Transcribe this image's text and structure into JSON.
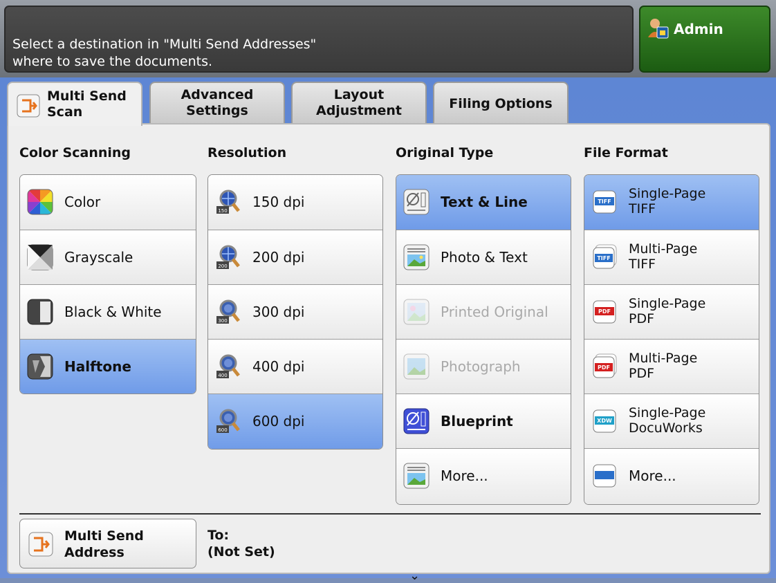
{
  "header": {
    "message_line1": "Select a destination in \"Multi Send Addresses\"",
    "message_line2": "where to save the documents.",
    "admin_label": "Admin",
    "admin_icon": "admin-user-icon"
  },
  "tabs": [
    {
      "line1": "Multi Send",
      "line2": "Scan",
      "active": true,
      "icon": "multi-send-scan-icon"
    },
    {
      "line1": "Advanced",
      "line2": "Settings"
    },
    {
      "line1": "Layout",
      "line2": "Adjustment"
    },
    {
      "line1": "Filing Options",
      "line2": ""
    }
  ],
  "columns": {
    "color_scanning": {
      "heading": "Color Scanning",
      "items": [
        {
          "label": "Color",
          "icon": "color-icon"
        },
        {
          "label": "Grayscale",
          "icon": "grayscale-icon"
        },
        {
          "label": "Black & White",
          "icon": "black-white-icon"
        },
        {
          "label": "Halftone",
          "icon": "halftone-icon",
          "selected": true
        }
      ]
    },
    "resolution": {
      "heading": "Resolution",
      "items": [
        {
          "label": "150 dpi",
          "badge": "150",
          "icon": "resolution-icon"
        },
        {
          "label": "200 dpi",
          "badge": "200",
          "icon": "resolution-icon"
        },
        {
          "label": "300 dpi",
          "badge": "300",
          "icon": "resolution-icon"
        },
        {
          "label": "400 dpi",
          "badge": "400",
          "icon": "resolution-icon"
        },
        {
          "label": "600 dpi",
          "badge": "600",
          "icon": "resolution-icon",
          "selected": true
        }
      ]
    },
    "original_type": {
      "heading": "Original Type",
      "items": [
        {
          "label": "Text & Line",
          "icon": "text-line-icon",
          "selected": true
        },
        {
          "label": "Photo & Text",
          "icon": "photo-text-icon"
        },
        {
          "label": "Printed Original",
          "icon": "printed-original-icon",
          "disabled": true
        },
        {
          "label": "Photograph",
          "icon": "photograph-icon",
          "disabled": true
        },
        {
          "label": "Blueprint",
          "icon": "blueprint-icon"
        },
        {
          "label": "More...",
          "icon": "more-icon"
        }
      ]
    },
    "file_format": {
      "heading": "File Format",
      "items": [
        {
          "line1": "Single-Page",
          "line2": "TIFF",
          "badge": "TIFF",
          "icon": "tiff-icon",
          "selected": true
        },
        {
          "line1": "Multi-Page",
          "line2": "TIFF",
          "badge": "TIFF",
          "icon": "tiff-icon"
        },
        {
          "line1": "Single-Page",
          "line2": "PDF",
          "badge": "PDF",
          "icon": "pdf-icon"
        },
        {
          "line1": "Multi-Page",
          "line2": "PDF",
          "badge": "PDF",
          "icon": "pdf-icon"
        },
        {
          "line1": "Single-Page",
          "line2": "DocuWorks",
          "badge": "XDW",
          "icon": "docuworks-icon"
        },
        {
          "line1": "More...",
          "line2": "",
          "icon": "more-icon"
        }
      ]
    }
  },
  "footer": {
    "address_button_line1": "Multi Send",
    "address_button_line2": "Address",
    "to_label": "To:",
    "to_value": "(Not Set)",
    "scroll_indicator": "⌄"
  },
  "colors": {
    "selected": "#7fa6ec",
    "background_blue": "#6389d6",
    "admin_green": "#2e7a1f"
  }
}
